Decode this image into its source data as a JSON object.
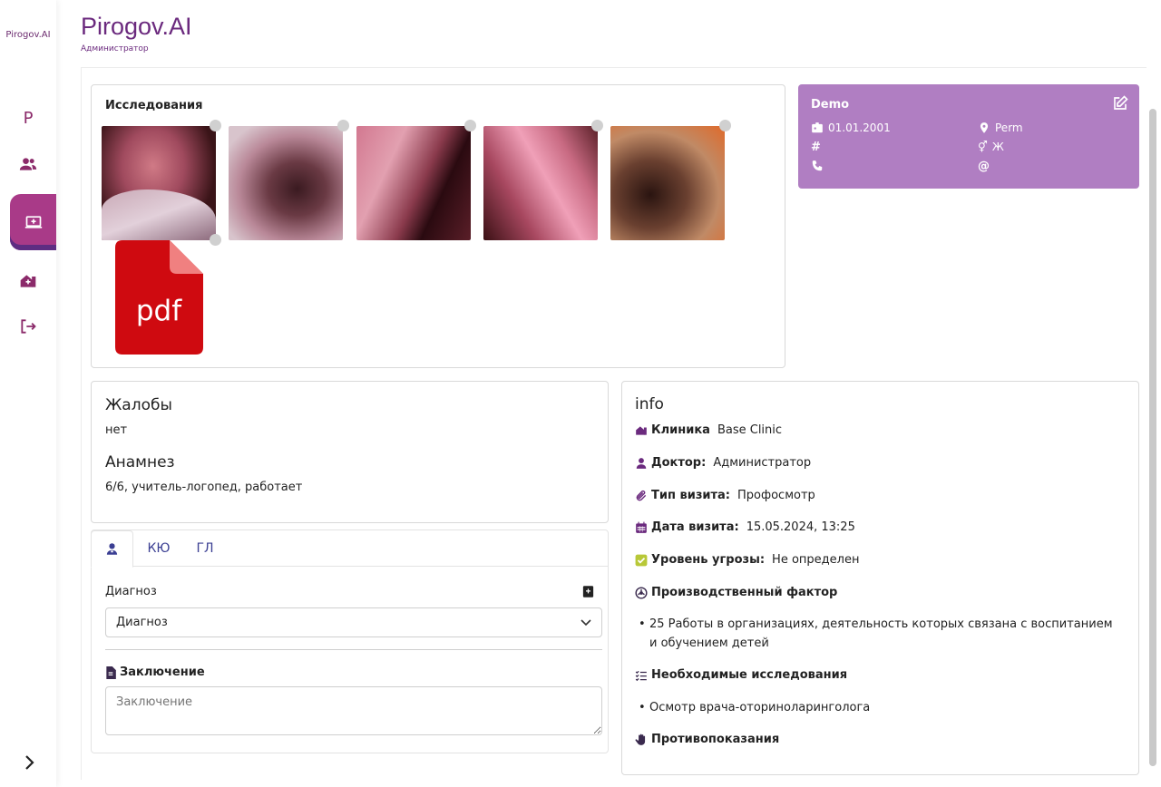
{
  "app": {
    "brand": "Pirogov.AI",
    "side_brand": "Pirogov.AI",
    "role": "Администратор"
  },
  "sidebar": {
    "items": [
      "logo-p-icon",
      "users-icon",
      "workstation-icon",
      "clinic-icon",
      "logout-icon"
    ]
  },
  "studies": {
    "title": "Исследования",
    "pdf_label": "pdf"
  },
  "patient": {
    "name": "Demo",
    "birth_date": "01.01.2001",
    "city": "Perm",
    "number": "",
    "gender": "Ж",
    "phone": "",
    "email": ""
  },
  "complaints": {
    "title": "Жалобы",
    "text": "нет"
  },
  "anamnesis": {
    "title": "Анамнез",
    "text": "6/6, учитель-логопед, работает"
  },
  "tabs": [
    {
      "label": ""
    },
    {
      "label": "КЮ"
    },
    {
      "label": "ГЛ"
    }
  ],
  "diagnosis": {
    "label": "Диагноз",
    "value": "Диагноз"
  },
  "conclusion": {
    "label": "Заключение",
    "placeholder": "Заключение"
  },
  "info": {
    "title": "info",
    "clinic_label": "Клиника",
    "clinic": "Base Clinic",
    "doctor_label": "Доктор:",
    "doctor": "Администратор",
    "visit_type_label": "Тип визита:",
    "visit_type": "Профосмотр",
    "visit_date_label": "Дата визита:",
    "visit_date": "15.05.2024, 13:25",
    "threat_label": "Уровень угрозы:",
    "threat": "Не определен",
    "factor_label": "Производственный фактор",
    "factor_item": "25 Работы в организациях, деятельность которых связана с воспитанием и обучением детей",
    "required_label": "Необходимые исследования",
    "required_item": "Осмотр врача-оториноларинголога",
    "contra_label": "Противопоказания"
  },
  "colors": {
    "accent": "#6b2a7e",
    "patient_card": "#b07ec2",
    "active_nav": "#a93a88",
    "tab_text": "#3b3f93"
  }
}
